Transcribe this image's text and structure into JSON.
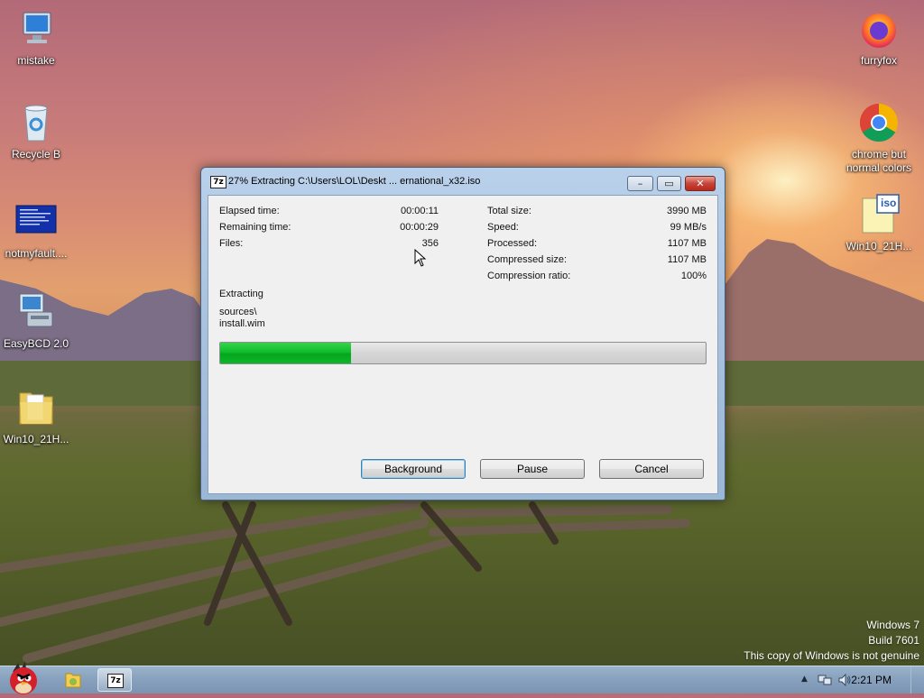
{
  "desktop": {
    "icons": [
      {
        "label": "mistake"
      },
      {
        "label": "Recycle B"
      },
      {
        "label": "notmyfault...."
      },
      {
        "label": "EasyBCD 2.0"
      },
      {
        "label": "Win10_21H..."
      },
      {
        "label": "furryfox"
      },
      {
        "label": "chrome but normal colors"
      },
      {
        "label": "Win10_21H..."
      }
    ],
    "iso_badge": "iso"
  },
  "dialog": {
    "title": "27% Extracting C:\\Users\\LOL\\Deskt ... ernational_x32.iso",
    "title_icon": "7z",
    "stats_left": [
      {
        "label": "Elapsed time:",
        "value": "00:00:11"
      },
      {
        "label": "Remaining time:",
        "value": "00:00:29"
      },
      {
        "label": "Files:",
        "value": "356"
      }
    ],
    "stats_right": [
      {
        "label": "Total size:",
        "value": "3990 MB"
      },
      {
        "label": "Speed:",
        "value": "99 MB/s"
      },
      {
        "label": "Processed:",
        "value": "1107 MB"
      },
      {
        "label": "Compressed size:",
        "value": "1107 MB"
      },
      {
        "label": "Compression ratio:",
        "value": "100%"
      }
    ],
    "status": "Extracting",
    "current_path": "sources\\",
    "current_file": "install.wim",
    "progress_percent": 27,
    "buttons": {
      "background": "Background",
      "pause": "Pause",
      "cancel": "Cancel"
    }
  },
  "taskbar": {
    "app_7z_label": "7z",
    "clock": "2:21 PM"
  },
  "watermark": {
    "line1": "Windows 7",
    "line2": "Build 7601",
    "line3": "This copy of Windows is not genuine"
  },
  "colors": {
    "progress_green": "#0ebd2b",
    "close_red": "#c7453a"
  }
}
